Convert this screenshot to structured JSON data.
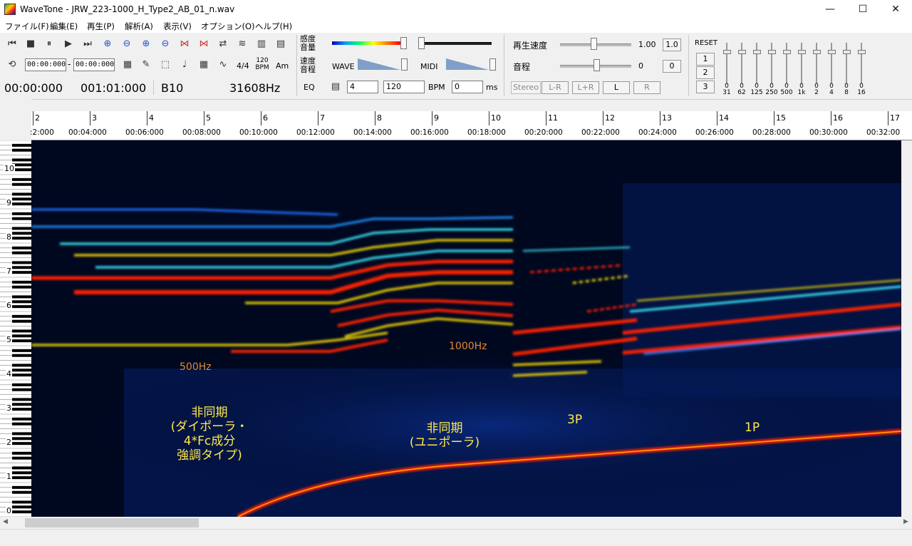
{
  "window": {
    "title": "WaveTone - JRW_223-1000_H_Type2_AB_01_n.wav",
    "min": "—",
    "max": "☐",
    "close": "✕"
  },
  "menu": [
    "ファイル(F)",
    "編集(E)",
    "再生(P)",
    "解析(A)",
    "表示(V)",
    "オプション(O)",
    "ヘルプ(H)"
  ],
  "toolbar": {
    "range_start": "00:00:000",
    "range_sep": "-",
    "range_end": "00:00:000",
    "time_sig": "4/4",
    "bpm_top": "120",
    "bpm_bottom": "BPM",
    "am": "Am",
    "time": "00:00:000",
    "measure": "001:01:000",
    "note": "B10",
    "freq": "31608Hz",
    "eq_label": "EQ",
    "sens_label_1": "感度",
    "sens_label_2": "音量",
    "speed_label_1": "速度",
    "speed_label_2": "音程",
    "wave_label": "WAVE",
    "midi_label": "MIDI",
    "beats_value": "4",
    "bpm_value": "120",
    "bpm_label": "BPM",
    "ms_value": "0",
    "ms_label": "ms",
    "playback_speed_label": "再生速度",
    "playback_speed_value": "1.00",
    "playback_speed_reset": "1.0",
    "pitch_label": "音程",
    "pitch_value": "0",
    "pitch_reset": "0",
    "stereo_label": "Stereo",
    "btn_lmr": "L-R",
    "btn_lpr": "L+R",
    "btn_l": "L",
    "btn_r": "R",
    "reset_label": "RESET",
    "preset_1": "1",
    "preset_2": "2",
    "preset_3": "3"
  },
  "eq_bands": [
    {
      "value": "0",
      "freq": "31"
    },
    {
      "value": "0",
      "freq": "62"
    },
    {
      "value": "0",
      "freq": "125"
    },
    {
      "value": "0",
      "freq": "250"
    },
    {
      "value": "0",
      "freq": "500"
    },
    {
      "value": "0",
      "freq": "1k"
    },
    {
      "value": "0",
      "freq": "2"
    },
    {
      "value": "0",
      "freq": "4"
    },
    {
      "value": "0",
      "freq": "8"
    },
    {
      "value": "0",
      "freq": "16"
    }
  ],
  "ruler": {
    "measures": [
      "2",
      "3",
      "4",
      "5",
      "6",
      "7",
      "8",
      "9",
      "10",
      "11",
      "12",
      "13",
      "14",
      "15",
      "16",
      "17"
    ],
    "times": [
      ":2:000",
      "00:04:000",
      "00:06:000",
      "00:08:000",
      "00:10:000",
      "00:12:000",
      "00:14:000",
      "00:16:000",
      "00:18:000",
      "00:20:000",
      "00:22:000",
      "00:24:000",
      "00:26:000",
      "00:28:000",
      "00:30:000",
      "00:32:00"
    ]
  },
  "octaves": [
    "10",
    "9",
    "8",
    "7",
    "6",
    "5",
    "4",
    "3",
    "2",
    "1",
    "0"
  ],
  "annotations": {
    "hz500": "500Hz",
    "hz1000": "1000Hz",
    "async_dipolar_1": "非同期",
    "async_dipolar_2": "(ダイポーラ・",
    "async_dipolar_3": "4*Fc成分",
    "async_dipolar_4": "強調タイプ)",
    "async_unipolar_1": "非同期",
    "async_unipolar_2": "(ユニポーラ)",
    "p3": "3P",
    "p1": "1P"
  },
  "colors": {
    "spectro_bg": "#000820",
    "hot": "#ff1a00",
    "warm": "#ffe000",
    "cool": "#00c8ff",
    "annotation": "#ffe94a"
  }
}
